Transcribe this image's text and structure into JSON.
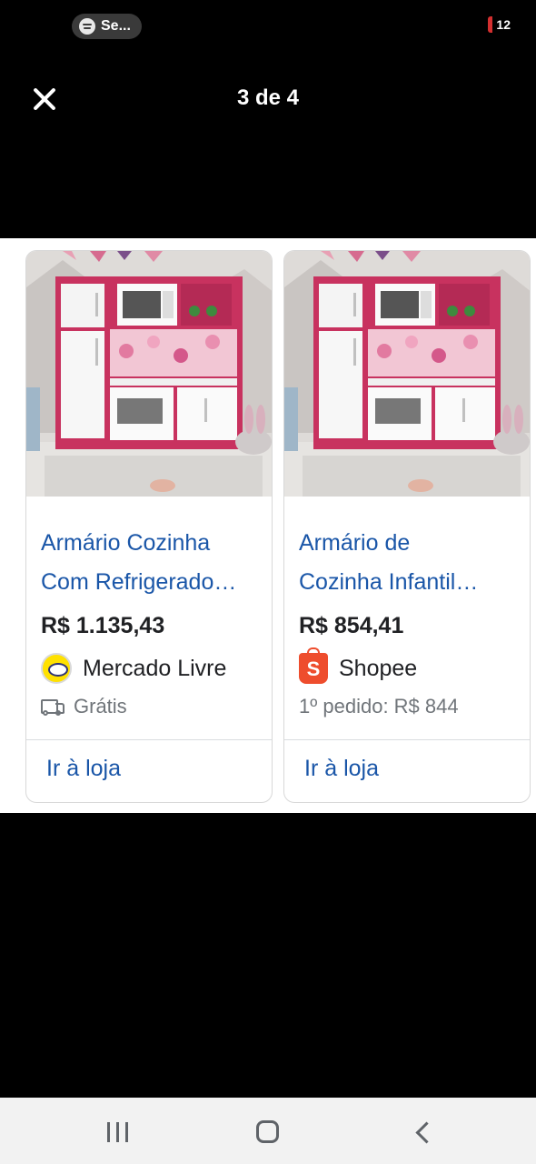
{
  "status_bar": {
    "media_pill_label": "Se...",
    "media_icon": "spotify-icon",
    "battery_text": "12",
    "battery_color": "#d32f2f"
  },
  "header": {
    "close_icon": "close-icon",
    "counter": "3 de 4"
  },
  "products": [
    {
      "title_line1": "Armário Cozinha",
      "title_line2": "Com Refrigerado…",
      "price": "R$ 1.135,43",
      "store": "Mercado Livre",
      "store_logo": "mercado-livre-logo",
      "meta": "Grátis",
      "meta_icon": "truck-icon",
      "link": "Ir à loja"
    },
    {
      "title_line1": "Armário de",
      "title_line2": "Cozinha Infantil…",
      "price": "R$ 854,41",
      "store": "Shopee",
      "store_logo": "shopee-logo",
      "meta": "1º pedido: R$ 844",
      "meta_icon": "",
      "link": "Ir à loja"
    }
  ],
  "nav_bar": {
    "recents_icon": "recents-icon",
    "home_icon": "home-icon",
    "back_icon": "back-icon"
  },
  "colors": {
    "link_blue": "#1a56a8",
    "cabinet_pink": "#c8325f",
    "shopee_orange": "#ee4d2d",
    "mercado_yellow": "#ffe100"
  }
}
